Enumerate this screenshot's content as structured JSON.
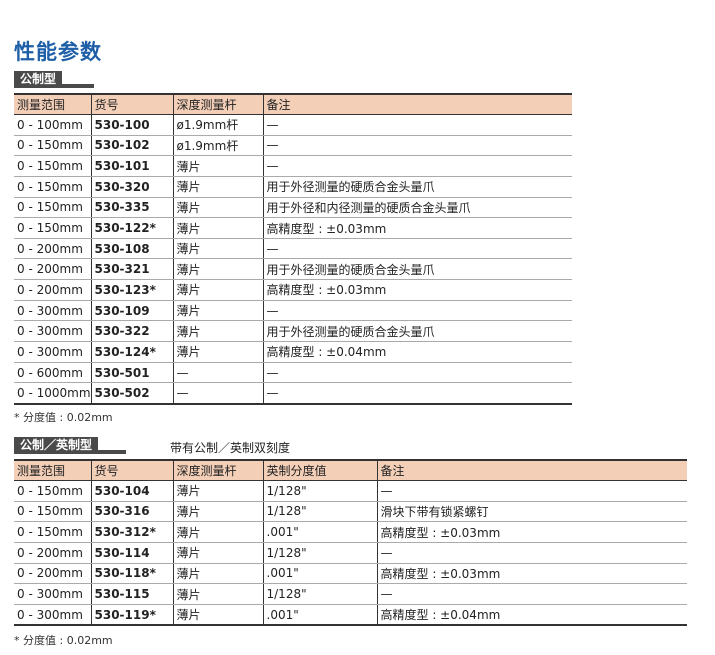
{
  "page_title": "性能参数",
  "metric": {
    "tag": "公制型",
    "headers": [
      "测量范围",
      "货号",
      "深度测量杆",
      "备注"
    ],
    "rows": [
      [
        "0 - 100mm",
        "530-100",
        "ø1.9mm杆",
        "—"
      ],
      [
        "0 - 150mm",
        "530-102",
        "ø1.9mm杆",
        "—"
      ],
      [
        "0 - 150mm",
        "530-101",
        "薄片",
        "—"
      ],
      [
        "0 - 150mm",
        "530-320",
        "薄片",
        "用于外径测量的硬质合金头量爪"
      ],
      [
        "0 - 150mm",
        "530-335",
        "薄片",
        "用于外径和内径测量的硬质合金头量爪"
      ],
      [
        "0 - 150mm",
        "530-122*",
        "薄片",
        "高精度型 : ±0.03mm"
      ],
      [
        "0 - 200mm",
        "530-108",
        "薄片",
        "—"
      ],
      [
        "0 - 200mm",
        "530-321",
        "薄片",
        "用于外径测量的硬质合金头量爪"
      ],
      [
        "0 - 200mm",
        "530-123*",
        "薄片",
        "高精度型 : ±0.03mm"
      ],
      [
        "0 - 300mm",
        "530-109",
        "薄片",
        "—"
      ],
      [
        "0 - 300mm",
        "530-322",
        "薄片",
        "用于外径测量的硬质合金头量爪"
      ],
      [
        "0 - 300mm",
        "530-124*",
        "薄片",
        "高精度型 : ±0.04mm"
      ],
      [
        "0 - 600mm",
        "530-501",
        "—",
        "—"
      ],
      [
        "0 - 1000mm",
        "530-502",
        "—",
        "—"
      ]
    ],
    "footnote": "* 分度值 : 0.02mm"
  },
  "inch": {
    "tag": "公制／英制型",
    "note": "带有公制／英制双刻度",
    "headers": [
      "测量范围",
      "货号",
      "深度测量杆",
      "英制分度值",
      "备注"
    ],
    "rows": [
      [
        "0 - 150mm",
        "530-104",
        "薄片",
        "1/128\"",
        "—"
      ],
      [
        "0 - 150mm",
        "530-316",
        "薄片",
        "1/128\"",
        "滑块下带有锁紧螺钉"
      ],
      [
        "0 - 150mm",
        "530-312*",
        "薄片",
        ".001\"",
        "高精度型 : ±0.03mm"
      ],
      [
        "0 - 200mm",
        "530-114",
        "薄片",
        "1/128\"",
        "—"
      ],
      [
        "0 - 200mm",
        "530-118*",
        "薄片",
        ".001\"",
        "高精度型 : ±0.03mm"
      ],
      [
        "0 - 300mm",
        "530-115",
        "薄片",
        "1/128\"",
        "—"
      ],
      [
        "0 - 300mm",
        "530-119*",
        "薄片",
        ".001\"",
        "高精度型 : ±0.04mm"
      ]
    ],
    "footnote": "* 分度值 : 0.02mm"
  }
}
